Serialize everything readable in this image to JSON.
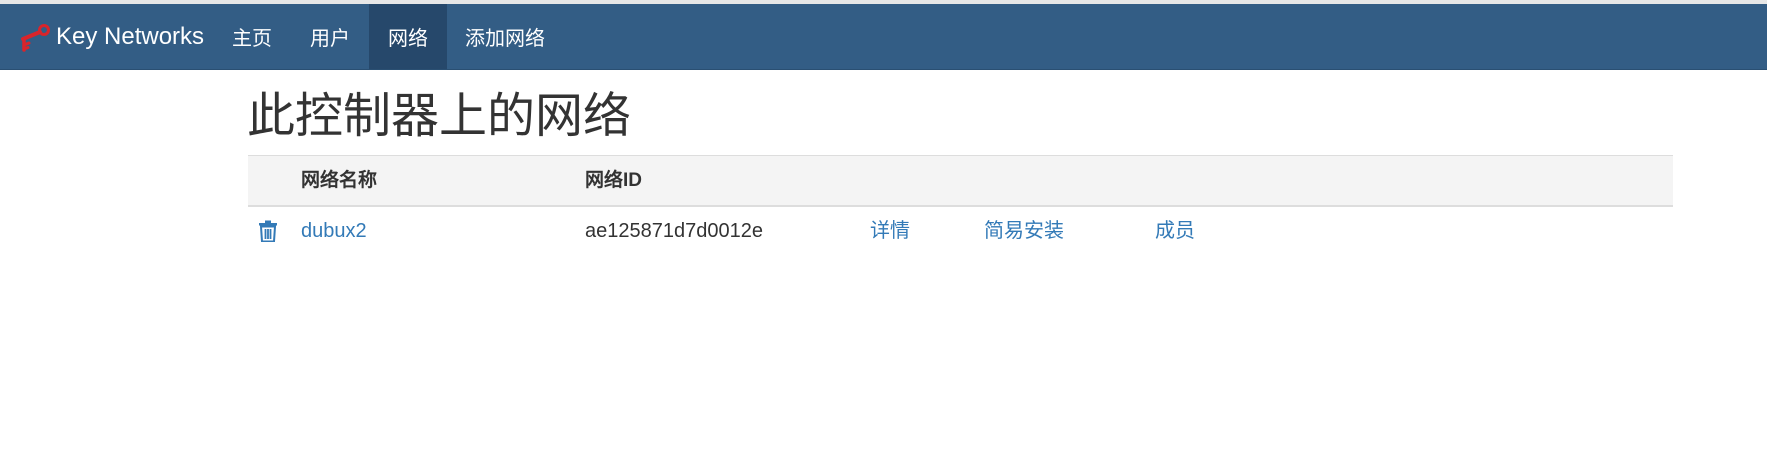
{
  "navbar": {
    "brand": "Key Networks",
    "items": [
      {
        "label": "主页"
      },
      {
        "label": "用户"
      },
      {
        "label": "网络"
      },
      {
        "label": "添加网络"
      }
    ]
  },
  "page": {
    "title": "此控制器上的网络"
  },
  "table": {
    "headers": {
      "name": "网络名称",
      "id": "网络ID"
    },
    "rows": [
      {
        "name": "dubux2",
        "id": "ae125871d7d0012e",
        "details": "详情",
        "easy_setup": "简易安装",
        "members": "成员"
      }
    ]
  },
  "colors": {
    "navbar": "#335d85",
    "navbar_active": "#26486b",
    "link": "#337ab7",
    "logo": "#d9242b"
  }
}
